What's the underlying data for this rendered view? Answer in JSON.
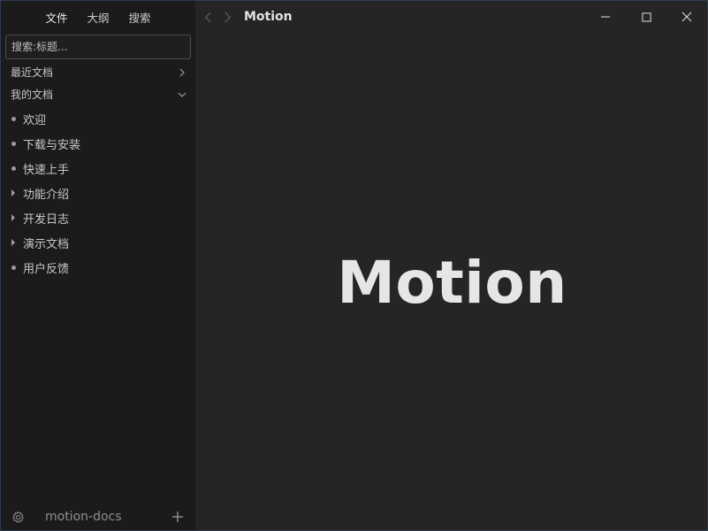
{
  "sidebar": {
    "tabs": [
      {
        "label": "文件",
        "active": true
      },
      {
        "label": "大纲",
        "active": false
      },
      {
        "label": "搜索",
        "active": false
      }
    ],
    "search": {
      "placeholder": "搜索:标题..."
    },
    "recent": {
      "label": "最近文档",
      "icon": "chevron-right-icon"
    },
    "mine": {
      "label": "我的文档",
      "icon": "chevron-down-icon"
    },
    "items": [
      {
        "label": "欢迎",
        "kind": "bullet"
      },
      {
        "label": "下载与安装",
        "kind": "bullet"
      },
      {
        "label": "快速上手",
        "kind": "bullet"
      },
      {
        "label": "功能介绍",
        "kind": "folder"
      },
      {
        "label": "开发日志",
        "kind": "folder"
      },
      {
        "label": "演示文档",
        "kind": "folder"
      },
      {
        "label": "用户反馈",
        "kind": "bullet"
      }
    ],
    "footer": {
      "title": "motion-docs",
      "settings_icon": "gear-icon",
      "add_icon": "plus-icon"
    }
  },
  "main": {
    "title": "Motion",
    "heading": "Motion"
  },
  "window_controls": [
    "minimize-icon",
    "maximize-icon",
    "close-icon"
  ],
  "colors": {
    "sidebar_bg": "#1b1b1b",
    "main_bg": "#252525",
    "text": "#c9c9c9",
    "heading": "#e6e6e6"
  }
}
